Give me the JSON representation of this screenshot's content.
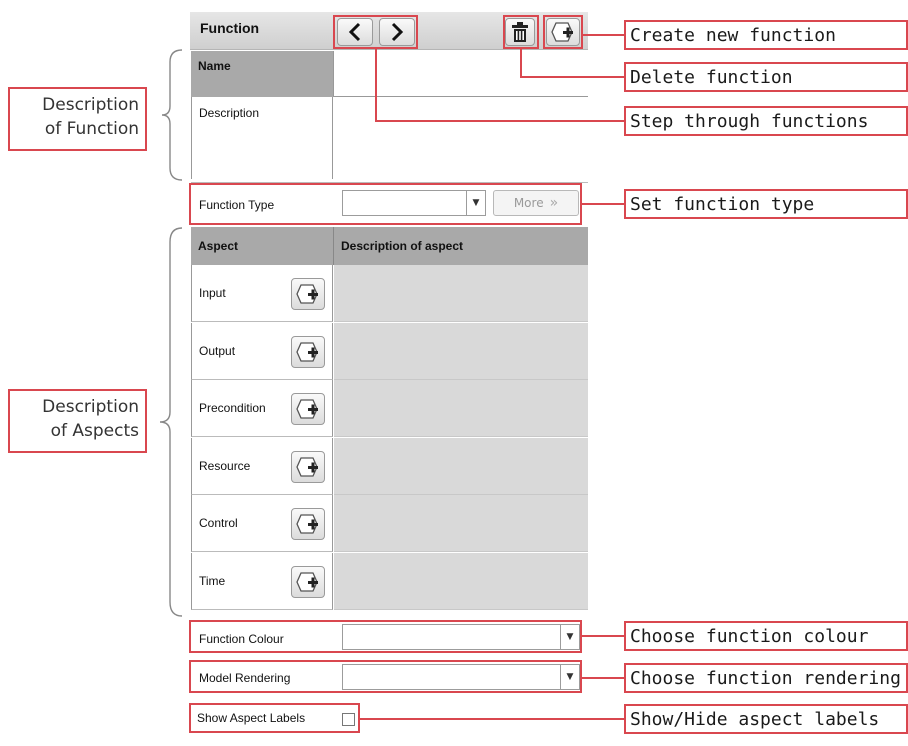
{
  "panel": {
    "header_title": "Function",
    "name_label": "Name",
    "description_label": "Description",
    "function_type_label": "Function Type",
    "function_type_value": "",
    "more_button": "More",
    "aspect_header": "Aspect",
    "aspect_desc_header": "Description of aspect",
    "aspects": [
      {
        "label": "Input"
      },
      {
        "label": "Output"
      },
      {
        "label": "Precondition"
      },
      {
        "label": "Resource"
      },
      {
        "label": "Control"
      },
      {
        "label": "Time"
      }
    ],
    "function_colour_label": "Function Colour",
    "function_colour_value": "",
    "model_rendering_label": "Model Rendering",
    "model_rendering_value": "",
    "show_aspect_labels": "Show Aspect Labels",
    "show_aspect_labels_checked": false
  },
  "callouts": {
    "create": "Create new function",
    "delete": "Delete function",
    "step": "Step through functions",
    "type": "Set function type",
    "colour": "Choose function colour",
    "rendering": "Choose function rendering",
    "labels": "Show/Hide aspect labels"
  },
  "side_labels": {
    "function_line1": "Description",
    "function_line2": "of Function",
    "aspects_line1": "Description",
    "aspects_line2": "of Aspects"
  },
  "icons": {
    "prev": "chevron-left-icon",
    "next": "chevron-right-icon",
    "delete": "trash-icon",
    "create": "add-shape-icon",
    "aspect_add": "add-shape-icon",
    "more": "double-chevron-right-icon",
    "dropdown": "triangle-down-icon"
  },
  "colors": {
    "annotation_red": "#d9474f",
    "header_gray": "#cfcfcf",
    "aspect_area_gray": "#d9d9d9",
    "name_cell_gray": "#a9a9a9"
  }
}
